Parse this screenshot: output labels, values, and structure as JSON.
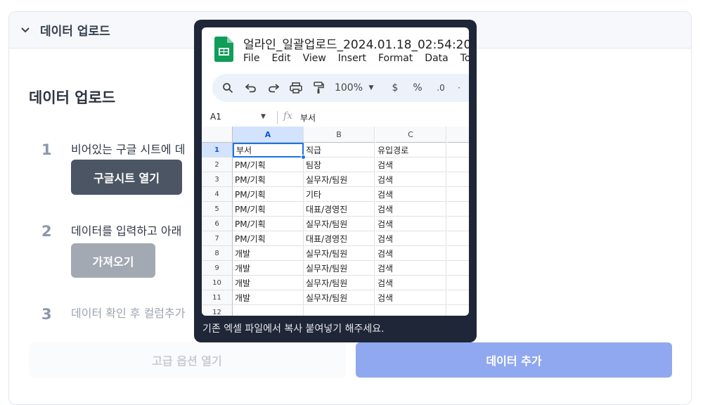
{
  "panel": {
    "header_title": "데이터 업로드"
  },
  "section": {
    "title": "데이터 업로드"
  },
  "steps": [
    {
      "number": "1",
      "text": "비어있는 구글 시트에 데"
    },
    {
      "number": "2",
      "text": "데이터를 입력하고 아래"
    },
    {
      "number": "3",
      "text": "데이터 확인 후 컬럼추가"
    }
  ],
  "buttons": {
    "open_sheet": "구글시트 열기",
    "import": "가져오기",
    "advanced": "고급 옵션 열기",
    "add_data": "데이터 추가"
  },
  "tooltip": {
    "caption": "기존 엑셀 파일에서 복사 붙여넣기 해주세요.",
    "sheet": {
      "title": "얼라인_일괄업로드_2024.01.18_02:54:20",
      "menu": [
        "File",
        "Edit",
        "View",
        "Insert",
        "Format",
        "Data",
        "Tools"
      ],
      "zoom": "100%",
      "currency": "$",
      "percent": "%",
      "decimal": ".0",
      "name_box": "A1",
      "fx": "fx",
      "formula_value": "부서",
      "columns": [
        "A",
        "B",
        "C"
      ],
      "row_numbers": [
        "1",
        "2",
        "3",
        "4",
        "5",
        "6",
        "7",
        "8",
        "9",
        "10",
        "11",
        "12"
      ],
      "rows": [
        [
          "부서",
          "직급",
          "유입경로"
        ],
        [
          "PM/기획",
          "팀장",
          "검색"
        ],
        [
          "PM/기획",
          "실무자/팀원",
          "검색"
        ],
        [
          "PM/기획",
          "기타",
          "검색"
        ],
        [
          "PM/기획",
          "대표/경영진",
          "검색"
        ],
        [
          "PM/기획",
          "실무자/팀원",
          "검색"
        ],
        [
          "PM/기획",
          "대표/경영진",
          "검색"
        ],
        [
          "개발",
          "실무자/팀원",
          "검색"
        ],
        [
          "개발",
          "실무자/팀원",
          "검색"
        ],
        [
          "개발",
          "실무자/팀원",
          "검색"
        ],
        [
          "개발",
          "실무자/팀원",
          "검색"
        ],
        [
          "",
          "",
          ""
        ]
      ]
    }
  },
  "colors": {
    "primary_button": "#4b5563",
    "disabled_button": "#a3a9b3",
    "accent": "#8fa8ef",
    "tooltip_bg": "#1f2637",
    "sheets_green": "#0f9d58"
  }
}
